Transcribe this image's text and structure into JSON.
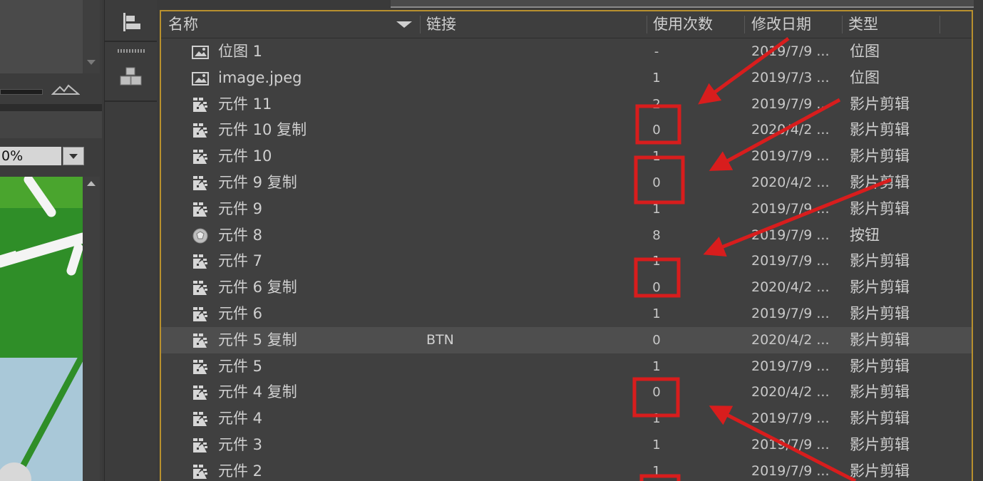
{
  "left_panel": {
    "zoom_value": "0%"
  },
  "library": {
    "columns": {
      "name": "名称",
      "linkage": "链接",
      "use_count": "使用次数",
      "date_modified": "修改日期",
      "type": "类型"
    },
    "items": [
      {
        "name": "位图 1",
        "linkage": "",
        "use_count": "-",
        "date_modified": "2019/7/9 ...",
        "type": "位图",
        "icon": "bitmap-icon",
        "selected": false
      },
      {
        "name": "image.jpeg",
        "linkage": "",
        "use_count": "1",
        "date_modified": "2019/7/3 ...",
        "type": "位图",
        "icon": "bitmap-icon",
        "selected": false
      },
      {
        "name": "元件 11",
        "linkage": "",
        "use_count": "2",
        "date_modified": "2019/7/9 ...",
        "type": "影片剪辑",
        "icon": "movieclip-icon",
        "selected": false
      },
      {
        "name": "元件 10 复制",
        "linkage": "",
        "use_count": "0",
        "date_modified": "2020/4/2 ...",
        "type": "影片剪辑",
        "icon": "movieclip-icon",
        "selected": false
      },
      {
        "name": "元件 10",
        "linkage": "",
        "use_count": "1",
        "date_modified": "2019/7/9 ...",
        "type": "影片剪辑",
        "icon": "movieclip-icon",
        "selected": false
      },
      {
        "name": "元件 9 复制",
        "linkage": "",
        "use_count": "0",
        "date_modified": "2020/4/2 ...",
        "type": "影片剪辑",
        "icon": "movieclip-icon",
        "selected": false
      },
      {
        "name": "元件 9",
        "linkage": "",
        "use_count": "1",
        "date_modified": "2019/7/9 ...",
        "type": "影片剪辑",
        "icon": "movieclip-icon",
        "selected": false
      },
      {
        "name": "元件 8",
        "linkage": "",
        "use_count": "8",
        "date_modified": "2019/7/9 ...",
        "type": "按钮",
        "icon": "button-symbol-icon",
        "selected": false
      },
      {
        "name": "元件 7",
        "linkage": "",
        "use_count": "1",
        "date_modified": "2019/7/9 ...",
        "type": "影片剪辑",
        "icon": "movieclip-icon",
        "selected": false
      },
      {
        "name": "元件 6 复制",
        "linkage": "",
        "use_count": "0",
        "date_modified": "2020/4/2 ...",
        "type": "影片剪辑",
        "icon": "movieclip-icon",
        "selected": false
      },
      {
        "name": "元件 6",
        "linkage": "",
        "use_count": "1",
        "date_modified": "2019/7/9 ...",
        "type": "影片剪辑",
        "icon": "movieclip-icon",
        "selected": false
      },
      {
        "name": "元件 5 复制",
        "linkage": "BTN",
        "use_count": "0",
        "date_modified": "2020/4/2 ...",
        "type": "影片剪辑",
        "icon": "movieclip-icon",
        "selected": true
      },
      {
        "name": "元件 5",
        "linkage": "",
        "use_count": "1",
        "date_modified": "2019/7/9 ...",
        "type": "影片剪辑",
        "icon": "movieclip-icon",
        "selected": false
      },
      {
        "name": "元件 4 复制",
        "linkage": "",
        "use_count": "0",
        "date_modified": "2020/4/2 ...",
        "type": "影片剪辑",
        "icon": "movieclip-icon",
        "selected": false
      },
      {
        "name": "元件 4",
        "linkage": "",
        "use_count": "1",
        "date_modified": "2019/7/9 ...",
        "type": "影片剪辑",
        "icon": "movieclip-icon",
        "selected": false
      },
      {
        "name": "元件 3",
        "linkage": "",
        "use_count": "1",
        "date_modified": "2019/7/9 ...",
        "type": "影片剪辑",
        "icon": "movieclip-icon",
        "selected": false
      },
      {
        "name": "元件 2",
        "linkage": "",
        "use_count": "1",
        "date_modified": "2019/7/9 ...",
        "type": "影片剪辑",
        "icon": "movieclip-icon",
        "selected": false
      }
    ]
  },
  "colors": {
    "panel_bg": "#404040",
    "panel_focus_border": "#b8902e",
    "annotation_red": "#d81d1d",
    "selected_row": "#4e4e4e"
  }
}
